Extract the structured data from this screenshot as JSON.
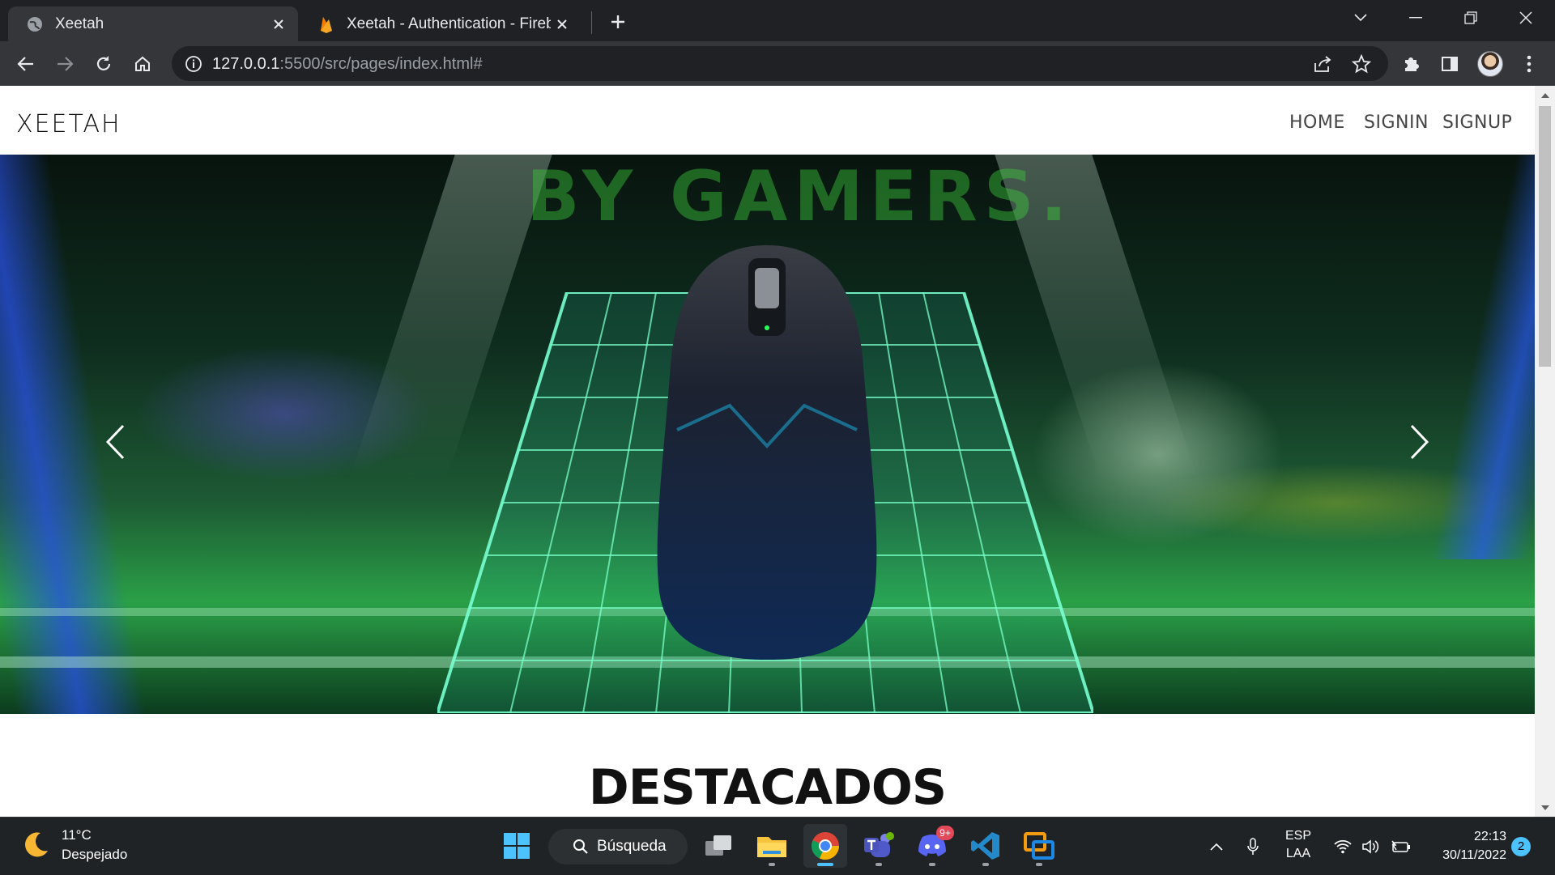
{
  "browser": {
    "tabs": [
      {
        "title": "Xeetah",
        "favicon": "globe-icon",
        "active": true
      },
      {
        "title": "Xeetah - Authentication - Firebas",
        "favicon": "firebase-icon",
        "active": false
      }
    ],
    "url_host": "127.0.0.1",
    "url_path": ":5500/src/pages/index.html#"
  },
  "site": {
    "brand": "XEETAH",
    "nav": {
      "home": "HOME",
      "signin": "SIGNIN",
      "signup": "SIGNUP"
    },
    "hero": {
      "ghost_text": "BY GAMERS."
    },
    "section_title": "DESTACADOS"
  },
  "taskbar": {
    "weather": {
      "temp": "11°C",
      "condition": "Despejado"
    },
    "search_label": "Búsqueda",
    "language": {
      "lang": "ESP",
      "layout": "LAA"
    },
    "time": "22:13",
    "date": "30/11/2022",
    "notifications": "2",
    "discord_badge": "9+"
  },
  "colors": {
    "accent": "#4cc2ff",
    "chrome_dark": "#202124",
    "chrome_toolbar": "#35363a",
    "taskbar": "#1f2326"
  }
}
